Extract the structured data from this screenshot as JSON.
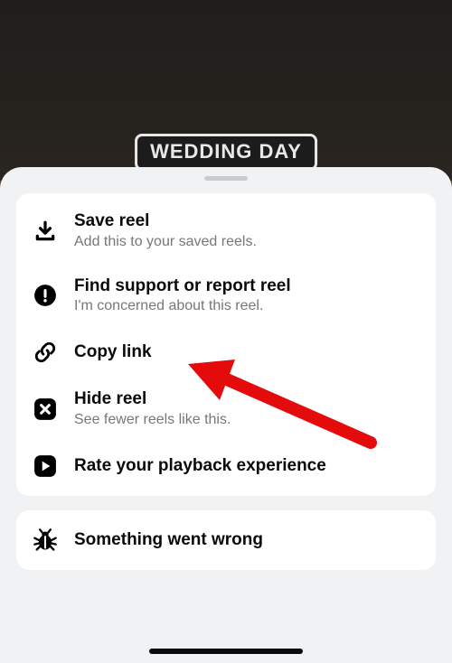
{
  "banner": {
    "text": "WEDDING DAY"
  },
  "menu": {
    "group1": [
      {
        "title": "Save reel",
        "subtitle": "Add this to your saved reels."
      },
      {
        "title": "Find support or report reel",
        "subtitle": "I'm concerned about this reel."
      },
      {
        "title": "Copy link",
        "subtitle": ""
      },
      {
        "title": "Hide reel",
        "subtitle": "See fewer reels like this."
      },
      {
        "title": "Rate your playback experience",
        "subtitle": ""
      }
    ],
    "group2": [
      {
        "title": "Something went wrong",
        "subtitle": ""
      }
    ]
  }
}
